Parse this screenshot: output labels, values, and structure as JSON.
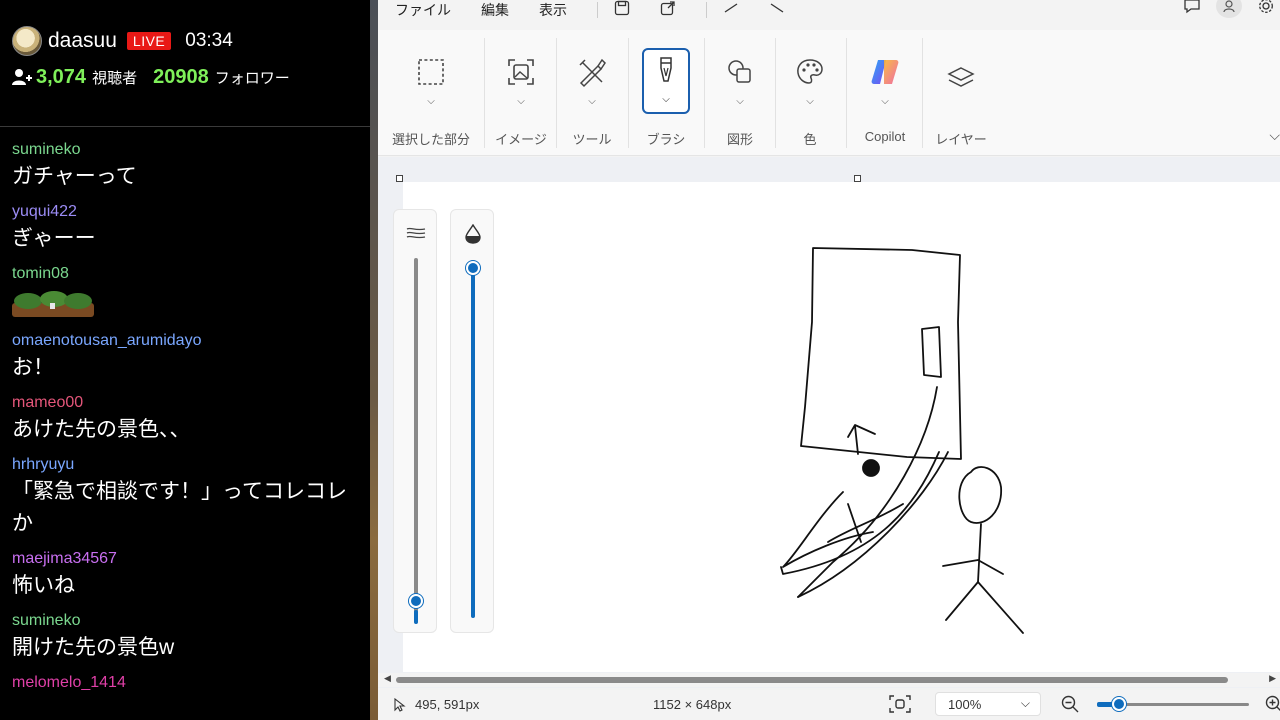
{
  "stream": {
    "streamer": "daasuu",
    "live_label": "LIVE",
    "elapsed": "03:34",
    "viewers": "3,074",
    "viewers_label": "視聴者",
    "followers": "20908",
    "followers_label": "フォロワー"
  },
  "chat": {
    "messages": [
      {
        "user": "sumineko",
        "text": "ガチャーって",
        "color": "#7bd88f"
      },
      {
        "user": "yuqui422",
        "text": "ぎゃーー",
        "color": "#9b8cf5"
      },
      {
        "user": "tomin08",
        "text": "",
        "emote": "emote",
        "color": "#7bd88f"
      },
      {
        "user": "omaenotousan_arumidayo",
        "text": "お！",
        "color": "#7aa7ff"
      },
      {
        "user": "mameo00",
        "text": "あけた先の景色、、",
        "color": "#e4567a"
      },
      {
        "user": "hrhryuyu",
        "text": "「緊急で相談です！」ってコレコレか",
        "color": "#7aa7ff"
      },
      {
        "user": "maejima34567",
        "text": "怖いね",
        "color": "#c86ff0"
      },
      {
        "user": "sumineko",
        "text": "開けた先の景色w",
        "color": "#7bd88f"
      },
      {
        "user": "melomelo_1414",
        "text": "",
        "color": "#e040a8"
      }
    ]
  },
  "paint": {
    "menu": {
      "file": "ファイル",
      "edit": "編集",
      "view": "表示"
    },
    "ribbon": {
      "selection": "選択した部分",
      "image": "イメージ",
      "tools": "ツール",
      "brushes": "ブラシ",
      "shapes": "図形",
      "colors": "色",
      "copilot": "Copilot",
      "layers": "レイヤー"
    },
    "status": {
      "cursor_position": "495, 591px",
      "canvas_size": "1152 × 648px",
      "zoom": "100%"
    },
    "accent_color": "#0f6cbd"
  }
}
